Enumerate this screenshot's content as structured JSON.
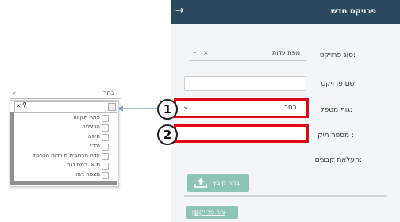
{
  "header": {
    "title": "פרויקט חדש",
    "back_arrow": "→"
  },
  "form": {
    "project_type": {
      "label": "סוג פרויקט:",
      "value": "מפת עדות",
      "clear": "×",
      "chevron": "⌄"
    },
    "project_name": {
      "label": "שם פרויקט:",
      "value": ""
    },
    "treating_body": {
      "label": "גוף מטפל:",
      "value": "בחר",
      "chevron": "⌄"
    },
    "file_number": {
      "label": "מספר תיק :",
      "value": ""
    },
    "upload": {
      "label": "העלאת קבצים:",
      "button": "בחר קובץ",
      "icon": "upload-icon"
    },
    "create_button": {
      "label": "צור פרויקט",
      "icon": "save-icon",
      "glyph": "🖫"
    }
  },
  "callouts": [
    "1",
    "2"
  ],
  "dropdown": {
    "selected": "בחר",
    "chevron": "⌄",
    "search_clear": "×",
    "search_icon": "⚲",
    "options": [
      "פתח תקווה",
      "הרצליה",
      "חיפה",
      "נת\"י",
      "עדה מרחבית מורדות הכרמל",
      "מ.א. רמת נגב",
      "מצפה רמון"
    ]
  },
  "colors": {
    "header": "#2c4a5e",
    "accent": "#8ec4b6",
    "highlight": "#e30613",
    "arrow": "#7fa8d0"
  }
}
